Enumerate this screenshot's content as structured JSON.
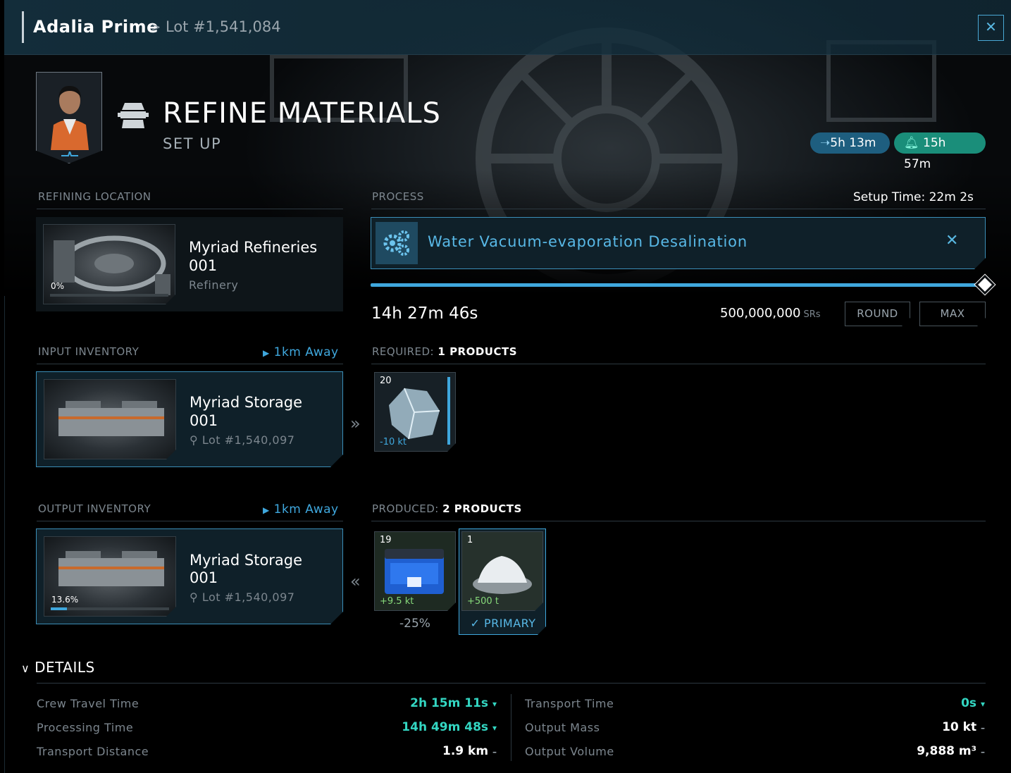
{
  "breadcrumb": {
    "asteroid": "Adalia Prime",
    "separator": ">",
    "lot": "Lot #1,541,084"
  },
  "close_label": "✕",
  "header": {
    "title": "REFINE MATERIALS",
    "subtitle": "SET UP"
  },
  "timers": {
    "travel": "5h 13m",
    "alarm": "15h 57m"
  },
  "location": {
    "label": "REFINING LOCATION",
    "name_line1": "Myriad Refineries",
    "name_line2": "001",
    "type": "Refinery",
    "fill_percent_text": "0%",
    "fill_fraction": 0
  },
  "input": {
    "label": "INPUT INVENTORY",
    "distance": "1km Away",
    "name_line1": "Myriad Storage",
    "name_line2": "001",
    "lot": "Lot #1,540,097"
  },
  "output": {
    "label": "OUTPUT INVENTORY",
    "distance": "1km Away",
    "name_line1": "Myriad Storage",
    "name_line2": "001",
    "lot": "Lot #1,540,097",
    "fill_percent_text": "13.6%",
    "fill_fraction": 0.136
  },
  "process": {
    "label": "PROCESS",
    "setup_time": "Setup Time: 22m 2s",
    "name": "Water Vacuum-evaporation Desalination",
    "clear": "✕",
    "slider_fraction": 1.0,
    "duration": "14h 27m 46s",
    "amount": "500,000,000",
    "amount_unit": "SRs",
    "round_label": "ROUND",
    "max_label": "MAX"
  },
  "required": {
    "label": "REQUIRED:",
    "count": "1 PRODUCTS",
    "items": [
      {
        "qty": "20",
        "amount": "-10 kt",
        "icon": "ice-crystal-icon"
      }
    ]
  },
  "produced": {
    "label": "PRODUCED:",
    "count": "2 PRODUCTS",
    "items": [
      {
        "qty": "19",
        "amount": "+9.5 kt",
        "note": "-25%",
        "icon": "blue-crate-icon"
      },
      {
        "qty": "1",
        "amount": "+500 t",
        "note": "✓ PRIMARY",
        "icon": "salt-pile-icon"
      }
    ]
  },
  "details": {
    "label": "DETAILS",
    "left": [
      {
        "label": "Crew Travel Time",
        "value": "2h 15m 11s",
        "trend": "▾"
      },
      {
        "label": "Processing Time",
        "value": "14h 49m 48s",
        "trend": "▾"
      },
      {
        "label": "Transport Distance",
        "value": "1.9 km",
        "trend": "–"
      }
    ],
    "right": [
      {
        "label": "Transport Time",
        "value": "0s",
        "trend": "▾"
      },
      {
        "label": "Output Mass",
        "value": "10 kt",
        "trend": "–"
      },
      {
        "label": "Output Volume",
        "value": "9,888 m³",
        "trend": "–"
      }
    ]
  },
  "colors": {
    "accent": "#3fa7dd",
    "teal": "#1a8e7a",
    "positive": "#33d6c2",
    "gain": "#86d97a"
  }
}
